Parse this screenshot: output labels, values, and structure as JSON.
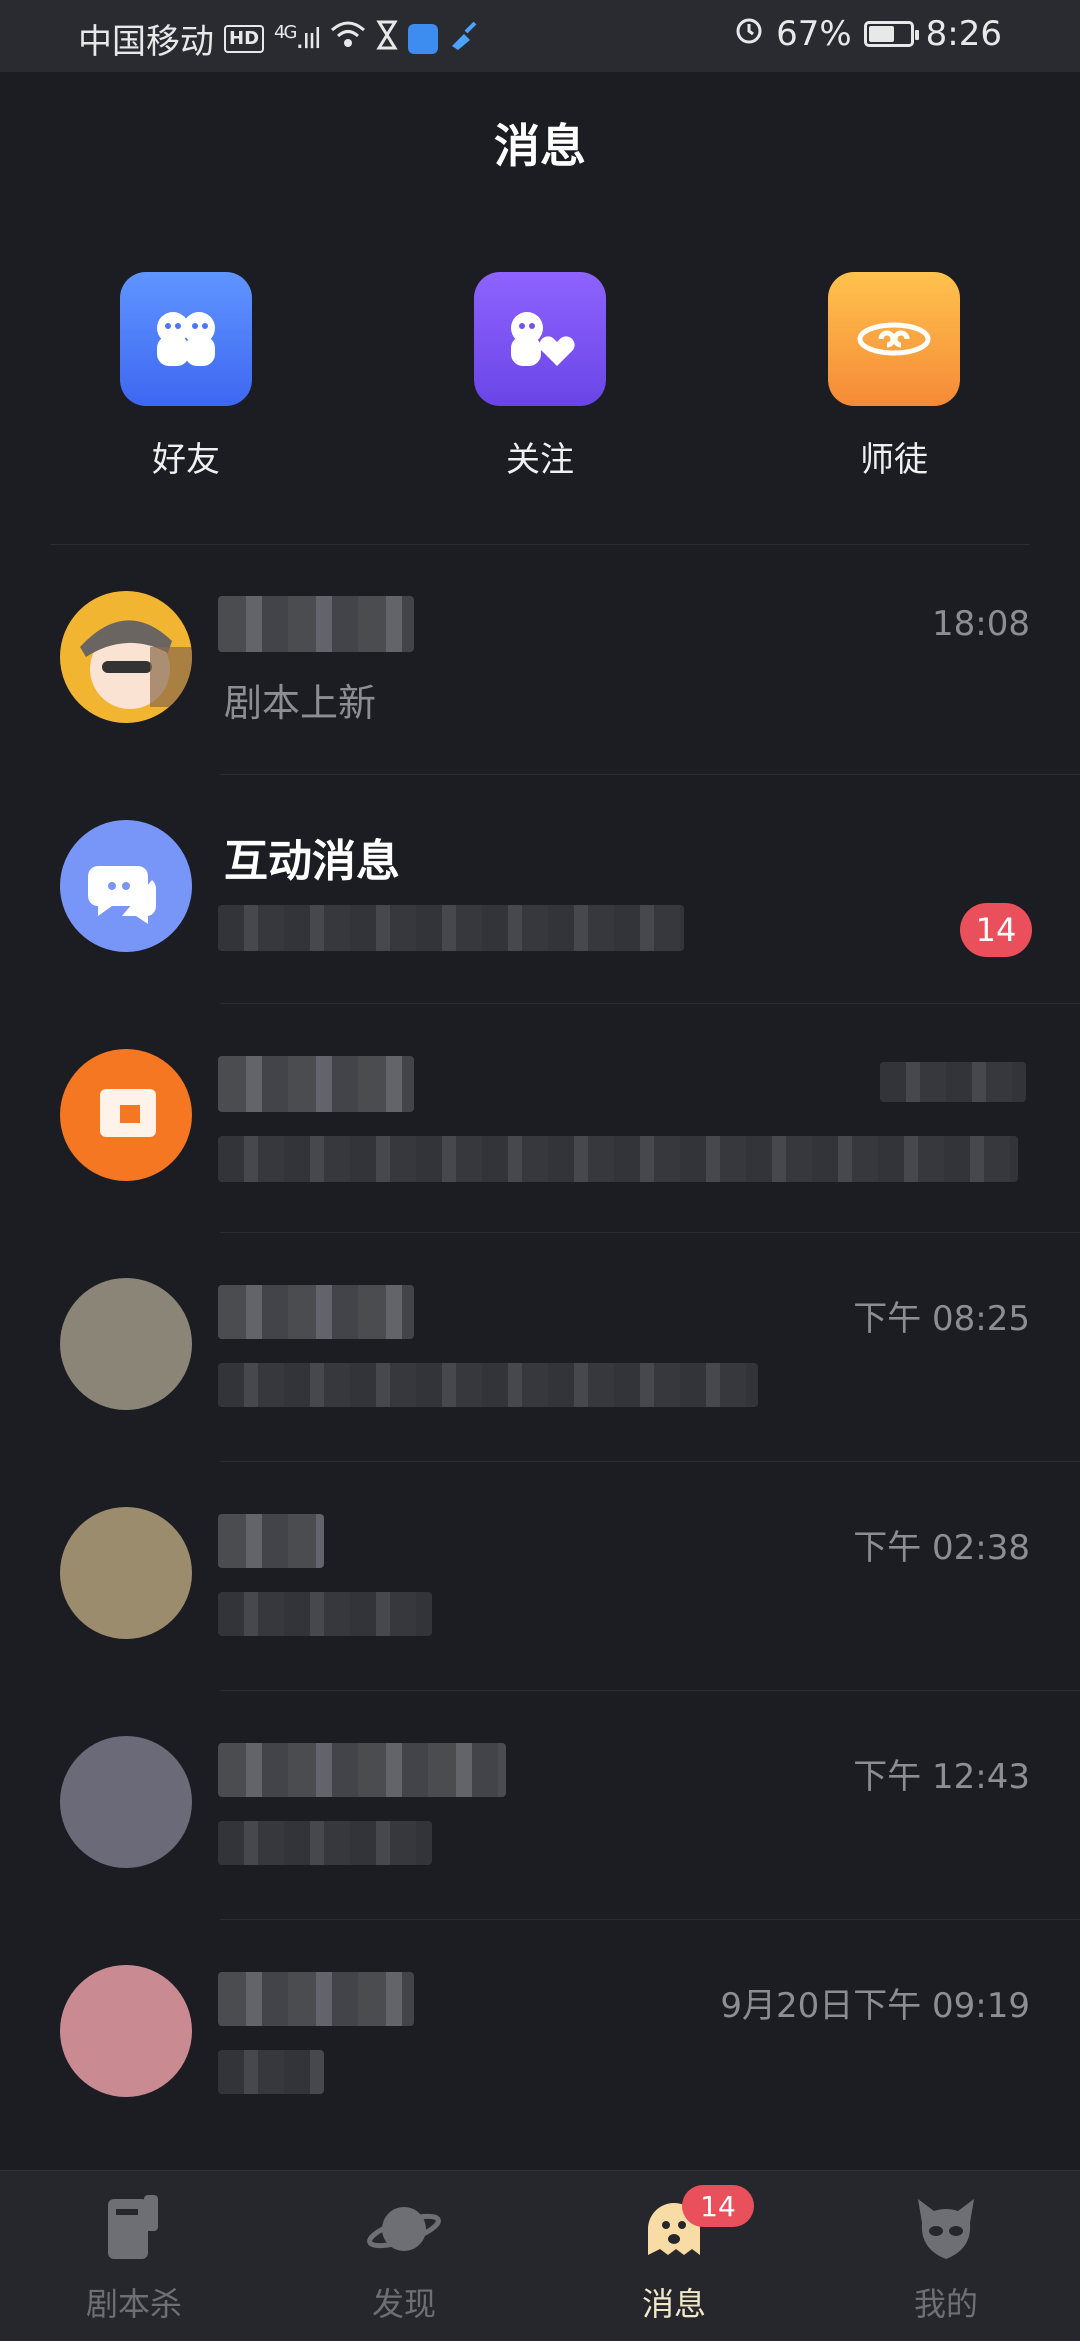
{
  "status_bar": {
    "carrier": "中国移动",
    "hd": "HD",
    "network": "4G",
    "battery": "67%",
    "battery_level": 0.67,
    "time": "8:26"
  },
  "header": {
    "title": "消息"
  },
  "shortcuts": [
    {
      "label": "好友",
      "icon": "friends-icon",
      "color": "#4e7bff"
    },
    {
      "label": "关注",
      "icon": "follow-heart-icon",
      "color": "#7a55f0"
    },
    {
      "label": "师徒",
      "icon": "cloud-swirl-icon",
      "color": "#f59a3c"
    }
  ],
  "messages": [
    {
      "name": "",
      "preview": "剧本上新",
      "time": "18:08"
    },
    {
      "name": "互动消息",
      "preview": "",
      "time": "",
      "badge": "14"
    },
    {
      "name": "",
      "preview": "",
      "time": ""
    },
    {
      "name": "",
      "preview": "",
      "time": "下午 08:25"
    },
    {
      "name": "",
      "preview": "",
      "time": "下午 02:38"
    },
    {
      "name": "",
      "preview": "",
      "time": "下午 12:43"
    },
    {
      "name": "",
      "preview": "",
      "time": "9月20日下午 09:19"
    }
  ],
  "tabs": [
    {
      "label": "剧本杀",
      "icon": "script-book-icon"
    },
    {
      "label": "发现",
      "icon": "planet-icon"
    },
    {
      "label": "消息",
      "icon": "ghost-chat-icon",
      "active": true,
      "badge": "14"
    },
    {
      "label": "我的",
      "icon": "alien-face-icon"
    }
  ],
  "colors": {
    "background": "#1c1d22",
    "badge": "#e9505c",
    "active_tab": "#f1e7c9"
  }
}
